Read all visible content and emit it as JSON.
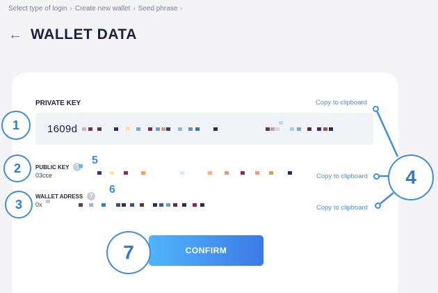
{
  "breadcrumb": [
    "Select type of login",
    "Create new wallet",
    "Seed phrase"
  ],
  "breadcrumb_separator": "›",
  "header": {
    "back_icon": "←",
    "title": "WALLET DATA"
  },
  "private_key": {
    "label": "PRIVATE KEY",
    "value": "1609d",
    "copy_label": "Copy to clipboard"
  },
  "public_key": {
    "label": "PUBLIC KEY",
    "value": "03cce",
    "copy_label": "Copy to clipboard",
    "help_icon": "?"
  },
  "wallet_address": {
    "label": "WALLET ADRESS",
    "value": "0x",
    "copy_label": "Copy to clipboard",
    "help_icon": "?"
  },
  "confirm_label": "CONFIRM",
  "markers": {
    "m1": "1",
    "m2": "2",
    "m3": "3",
    "m4": "4",
    "m5": "5",
    "m6": "6",
    "m7": "7"
  },
  "colors": {
    "accent": "#3e8de0",
    "link": "#4a8ee6",
    "title": "#1b2040"
  }
}
